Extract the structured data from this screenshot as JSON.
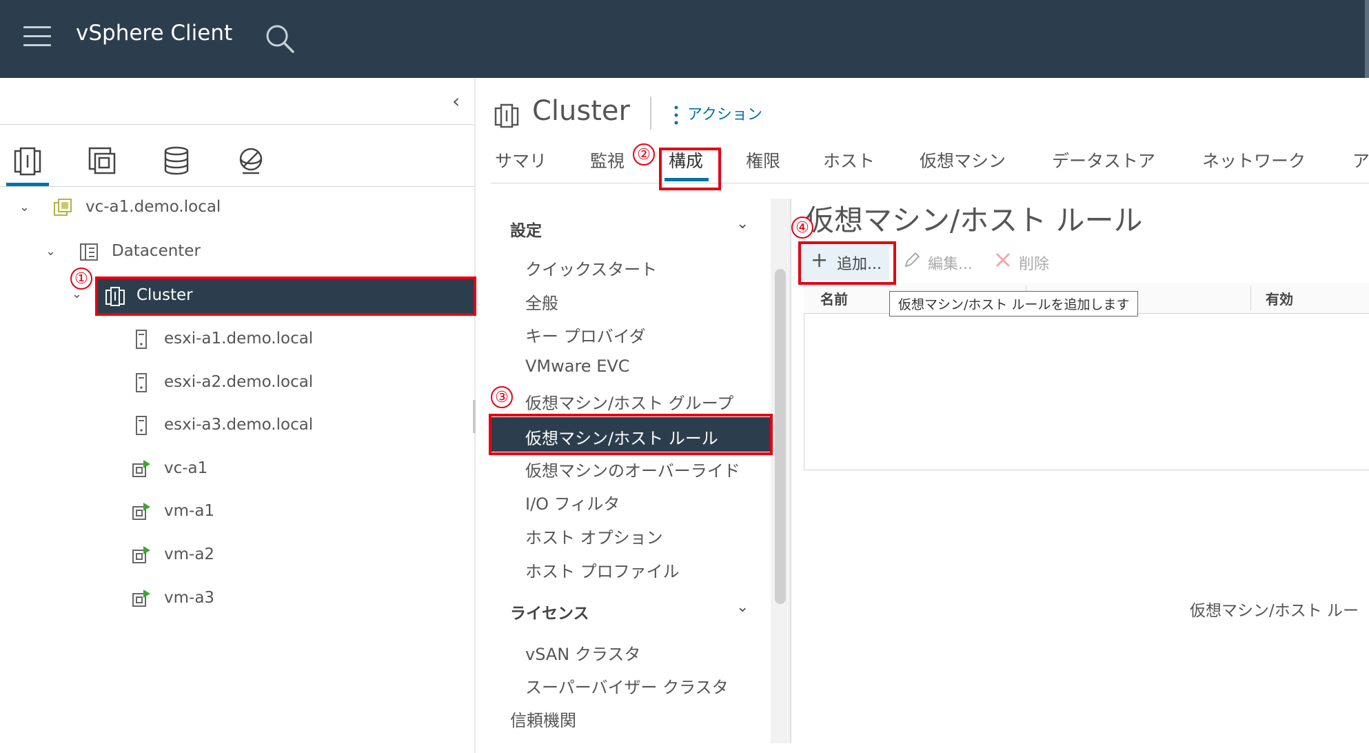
{
  "header": {
    "app_title": "vSphere Client"
  },
  "navigator": {
    "tree": [
      {
        "label": "vc-a1.demo.local",
        "icon": "vcenter-icon"
      },
      {
        "label": "Datacenter",
        "icon": "datacenter-icon"
      },
      {
        "label": "Cluster",
        "icon": "cluster-icon",
        "selected": true
      },
      {
        "label": "esxi-a1.demo.local",
        "icon": "host-icon"
      },
      {
        "label": "esxi-a2.demo.local",
        "icon": "host-icon"
      },
      {
        "label": "esxi-a3.demo.local",
        "icon": "host-icon"
      },
      {
        "label": "vc-a1",
        "icon": "vm-icon"
      },
      {
        "label": "vm-a1",
        "icon": "vm-icon"
      },
      {
        "label": "vm-a2",
        "icon": "vm-icon"
      },
      {
        "label": "vm-a3",
        "icon": "vm-icon"
      }
    ]
  },
  "object": {
    "title": "Cluster",
    "actions_label": "アクション",
    "tabs": [
      "サマリ",
      "監視",
      "構成",
      "権限",
      "ホスト",
      "仮想マシン",
      "データストア",
      "ネットワーク",
      "ア"
    ],
    "active_tab": "構成"
  },
  "config": {
    "sections": [
      {
        "label": "設定"
      },
      {
        "label": "ライセンス"
      }
    ],
    "items": [
      "クイックスタート",
      "全般",
      "キー プロバイダ",
      "VMware EVC",
      "仮想マシン/ホスト グループ",
      "仮想マシン/ホスト ルール",
      "仮想マシンのオーバーライド",
      "I/O フィルタ",
      "ホスト オプション",
      "ホスト プロファイル",
      "vSAN クラスタ",
      "スーパーバイザー クラスタ",
      "信頼機関"
    ],
    "selected_item": "仮想マシン/ホスト ルール"
  },
  "rules": {
    "title": "仮想マシン/ホスト ルール",
    "add_label": "追加...",
    "edit_label": "編集...",
    "delete_label": "削除",
    "columns": [
      "名前",
      "有効"
    ],
    "tooltip": "仮想マシン/ホスト ルールを追加します",
    "footer_text": "仮想マシン/ホスト ルー"
  },
  "annotations": [
    "①",
    "②",
    "③",
    "④"
  ],
  "colors": {
    "header_bg": "#2c3e4d",
    "selected_bg": "#2c3e4d",
    "accent": "#0072a3",
    "annotation": "#e60012"
  }
}
